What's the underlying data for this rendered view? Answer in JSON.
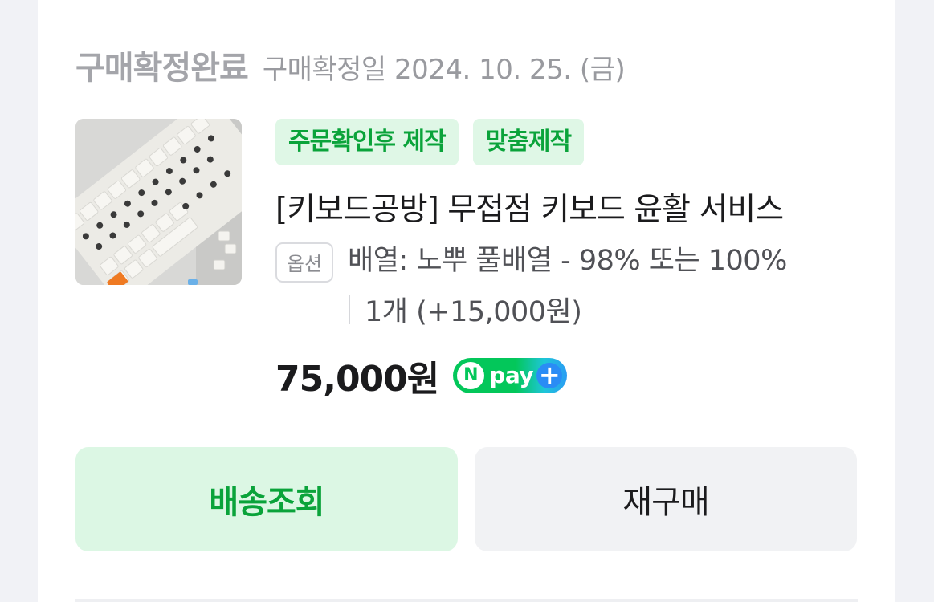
{
  "order": {
    "status_title": "구매확정완료",
    "status_date": "구매확정일 2024. 10. 25. (금)"
  },
  "product": {
    "tags": [
      "주문확인후 제작",
      "맞춤제작"
    ],
    "name": "[키보드공방] 무접점 키보드 윤활 서비스",
    "option_chip": "옵션",
    "option_text": "배열: 노뿌 풀배열 - 98% 또는 100%",
    "quantity_text": "1개 (+15,000원)",
    "price": "75,000원",
    "pay_badge": {
      "n": "N",
      "label": "pay",
      "plus": "+"
    }
  },
  "actions": {
    "track_label": "배송조회",
    "rebuy_label": "재구매"
  },
  "colors": {
    "accent_green": "#0aa33a",
    "accent_bg": "#dcf7e4",
    "npay_green": "#03c75a",
    "npay_blue": "#2a8cf5"
  }
}
